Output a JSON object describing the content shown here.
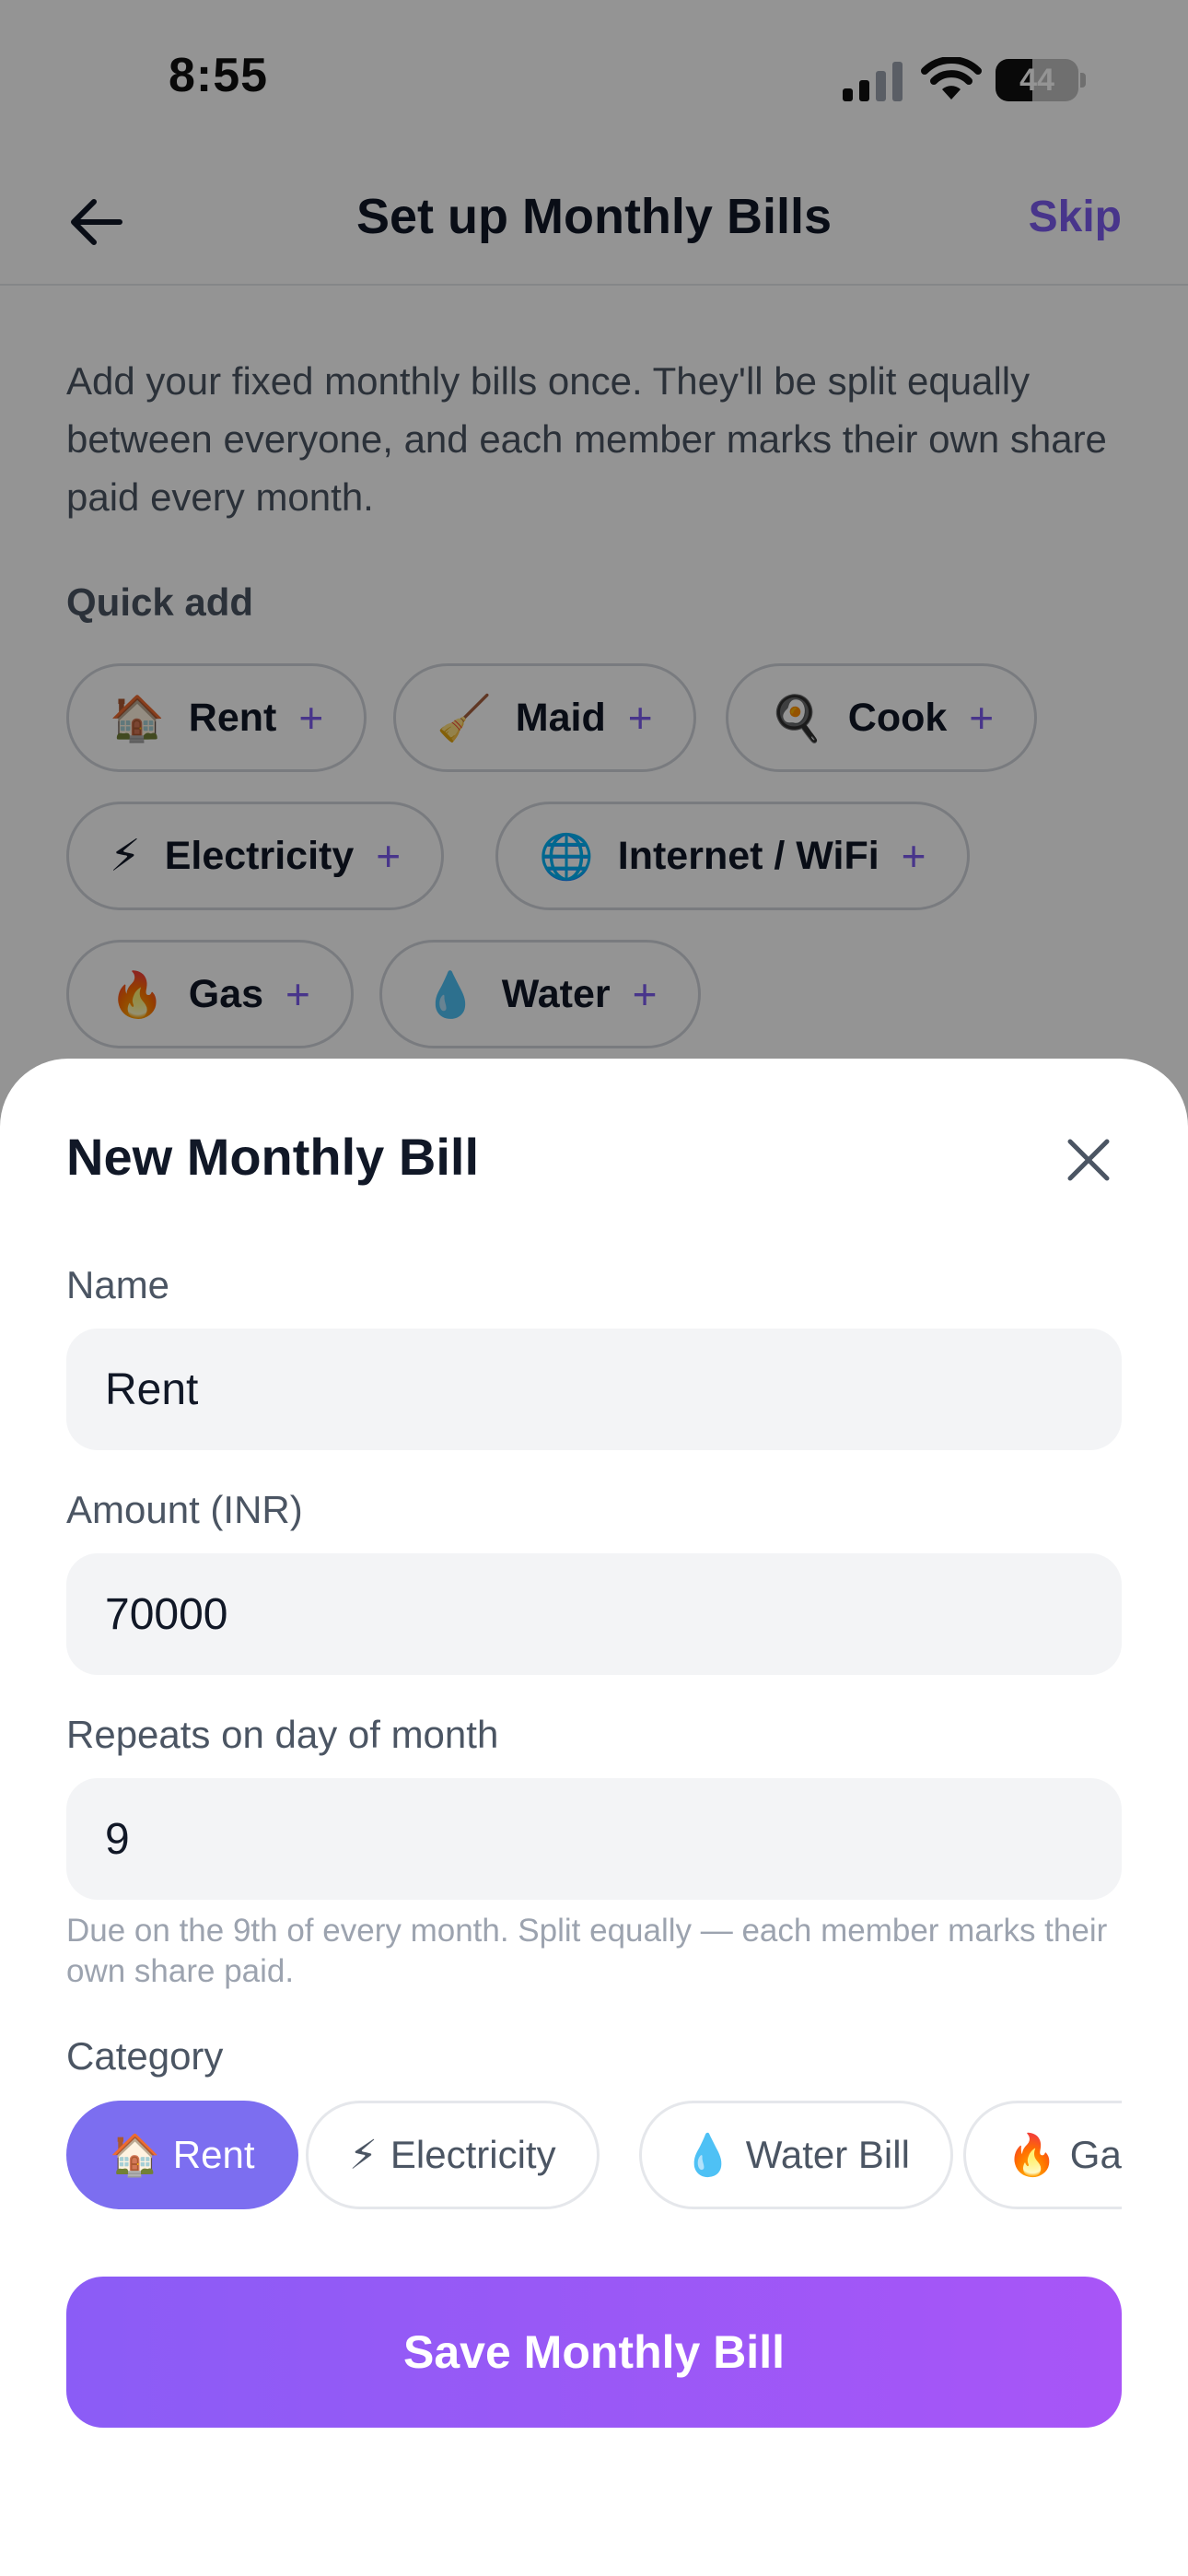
{
  "status_bar": {
    "time": "8:55",
    "battery_level": "44",
    "battery_fraction": 0.44
  },
  "nav": {
    "title": "Set up Monthly Bills",
    "skip_label": "Skip",
    "back_icon": "arrow-left-icon"
  },
  "intro": {
    "text": "Add your fixed monthly bills once. They'll be split equally between everyone, and each member marks their own share paid every month."
  },
  "quick_add": {
    "label": "Quick add",
    "items": [
      {
        "emoji": "🏠",
        "label": "Rent",
        "plus": "+"
      },
      {
        "emoji": "🧹",
        "label": "Maid",
        "plus": "+"
      },
      {
        "emoji": "🍳",
        "label": "Cook",
        "plus": "+"
      },
      {
        "emoji": "⚡",
        "label": "Electricity",
        "plus": "+"
      },
      {
        "emoji": "🌐",
        "label": "Internet / WiFi",
        "plus": "+"
      },
      {
        "emoji": "🔥",
        "label": "Gas",
        "plus": "+"
      },
      {
        "emoji": "💧",
        "label": "Water",
        "plus": "+"
      }
    ]
  },
  "sheet": {
    "title": "New Monthly Bill",
    "close_icon": "close-icon",
    "name_label": "Name",
    "name_value": "Rent",
    "amount_label": "Amount (INR)",
    "amount_value": "70000",
    "day_label": "Repeats on day of month",
    "day_value": "9",
    "helper_text": "Due on the 9th of every month. Split equally — each member marks their own share paid.",
    "category_label": "Category",
    "categories": [
      {
        "emoji": "🏠",
        "label": "Rent",
        "selected": true
      },
      {
        "emoji": "⚡",
        "label": "Electricity",
        "selected": false
      },
      {
        "emoji": "💧",
        "label": "Water Bill",
        "selected": false
      },
      {
        "emoji": "🔥",
        "label": "Gas",
        "selected": false
      }
    ],
    "save_label": "Save Monthly Bill"
  },
  "colors": {
    "accent": "#7c5cf0",
    "selected_chip": "#7c6ef0",
    "button_start": "#8b5cf6",
    "button_end": "#a855f7"
  }
}
